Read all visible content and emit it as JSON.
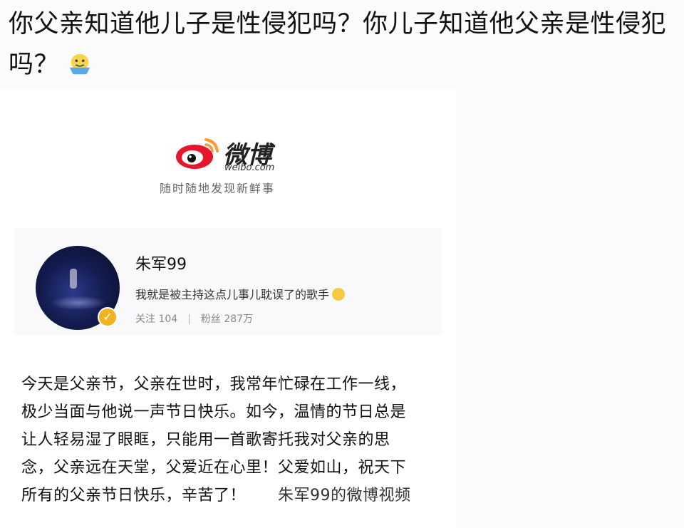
{
  "caption": {
    "text": "你父亲知道他儿子是性侵犯吗？你儿子知道他父亲是性侵犯吗？"
  },
  "icons": {
    "caption_emoji": "smirk-face-emoji-icon",
    "weibo_logo": "weibo-eye-logo",
    "verified": "verified-badge-icon",
    "bio_emoji": "face-emoji-icon"
  },
  "weibo": {
    "wordmark": "微博",
    "domain": "weibo.com",
    "tagline": "随时随地发现新鲜事"
  },
  "profile": {
    "name": "朱军99",
    "bio": "我就是被主持这点儿事儿耽误了的歌手",
    "following_label": "关注",
    "following_count": "104",
    "followers_label": "粉丝",
    "followers_count": "287万"
  },
  "post": {
    "text": "今天是父亲节，父亲在世时，我常年忙碌在工作一线，极少当面与他说一声节日快乐。如今，温情的节日总是让人轻易湿了眼眶，只能用一首歌寄托我对父亲的思念，父亲远在天堂，父爱近在心里！父爱如山，祝天下所有的父亲节日快乐，辛苦了！",
    "link": "朱军99的微博视频"
  },
  "colors": {
    "weibo_red": "#e6162d",
    "weibo_orange": "#ff9933",
    "badge_gold": "#f0b322"
  }
}
